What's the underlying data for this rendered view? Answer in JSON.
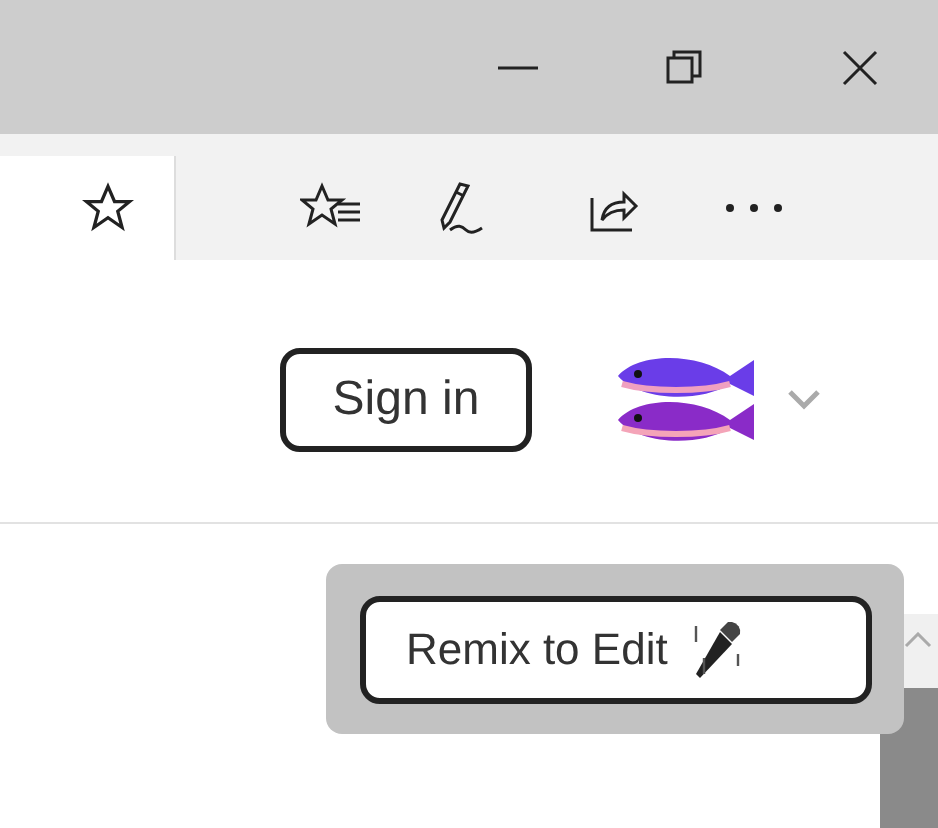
{
  "header": {
    "sign_in_button": "Sign in"
  },
  "popup": {
    "remix_button": "Remix to Edit"
  }
}
